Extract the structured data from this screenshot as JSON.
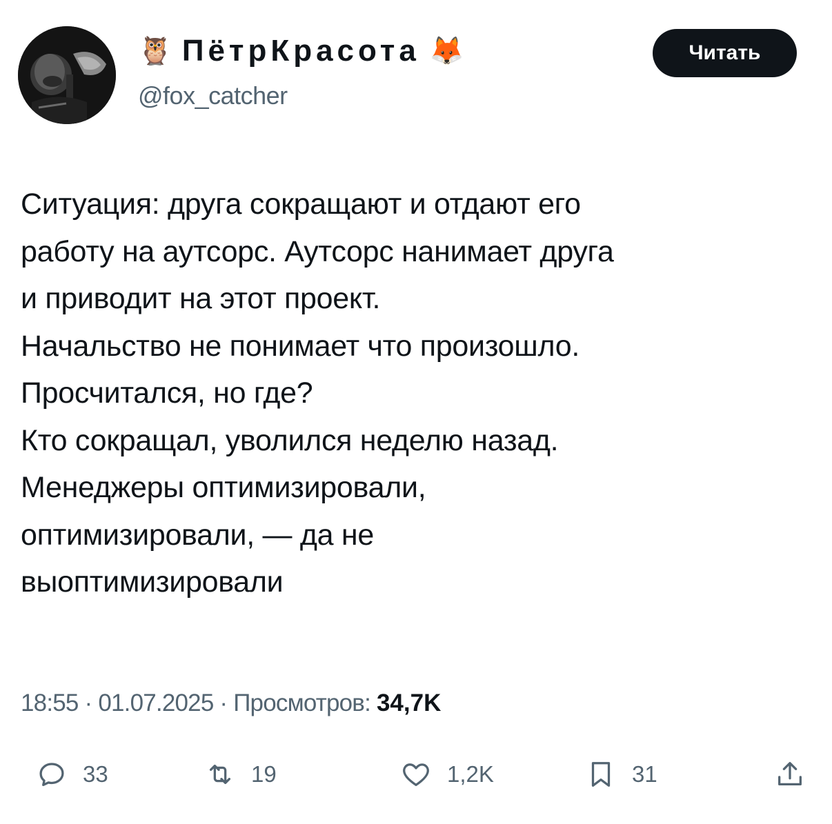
{
  "author": {
    "prefix_emoji": "🦉",
    "display_name": "ПётрКрасота",
    "suffix_emoji": "🦊",
    "handle": "@fox_catcher"
  },
  "follow_button": {
    "label": "Читать"
  },
  "tweet": {
    "lines": [
      "Ситуация: друга сокращают и отдают его",
      "работу на аутсорс. Аутсорс нанимает друга",
      "и приводит на этот проект.",
      "Начальство не понимает что произошло.",
      "Просчитался, но где?",
      "Кто сокращал, уволился неделю назад.",
      "Менеджеры оптимизировали,",
      "оптимизировали, — да не",
      "выоптимизировали"
    ]
  },
  "meta": {
    "time": "18:55",
    "date": "01.07.2025",
    "views_label": "Просмотров:",
    "views_count": "34,7K"
  },
  "actions": {
    "replies": {
      "icon": "reply-icon",
      "count": "33"
    },
    "reposts": {
      "icon": "repost-icon",
      "count": "19"
    },
    "likes": {
      "icon": "heart-icon",
      "count": "1,2K"
    },
    "bookmarks": {
      "icon": "bookmark-icon",
      "count": "31"
    },
    "share": {
      "icon": "share-icon"
    }
  },
  "colors": {
    "text": "#0f1419",
    "secondary": "#536471",
    "button_bg": "#0f1419",
    "button_text": "#ffffff"
  }
}
